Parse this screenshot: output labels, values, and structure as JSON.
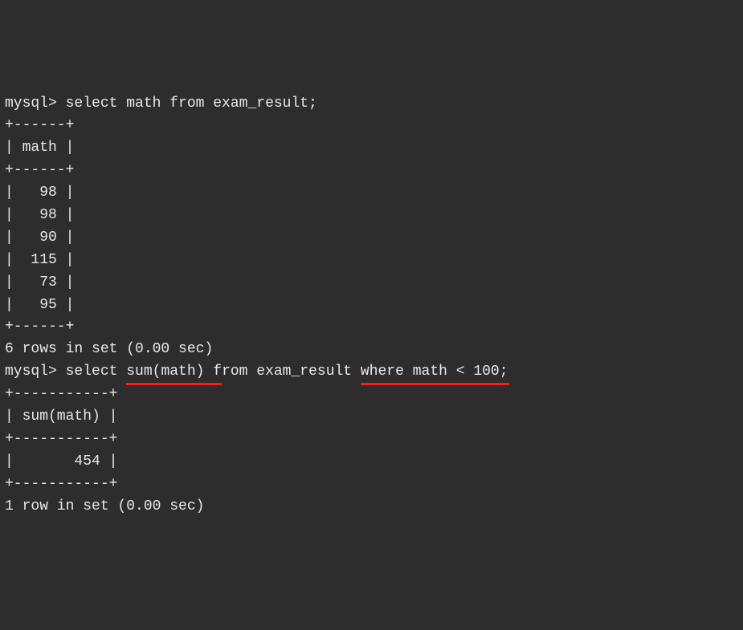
{
  "terminal": {
    "prompt": "mysql>",
    "query1": "select math from exam_result;",
    "table1": {
      "top_border": "+------+",
      "header_row": "| math |",
      "mid_border": "+------+",
      "rows": [
        "|   98 |",
        "|   98 |",
        "|   90 |",
        "|  115 |",
        "|   73 |",
        "|   95 |"
      ],
      "bottom_border": "+------+"
    },
    "result1_msg": "6 rows in set (0.00 sec)",
    "blank": "",
    "query2_prefix": "select ",
    "query2_sum": "sum(math)",
    "query2_mid": " from exam_result ",
    "query2_where": "where math < 100",
    "query2_suffix": ";",
    "table2": {
      "top_border": "+-----------+",
      "header_row": "| sum(math) |",
      "mid_border": "+-----------+",
      "data_row": "|       454 |",
      "bottom_border": "+-----------+"
    },
    "result2_msg": "1 row in set (0.00 sec)"
  },
  "chart_data": [
    {
      "type": "table",
      "title": "select math from exam_result",
      "columns": [
        "math"
      ],
      "rows": [
        [
          98
        ],
        [
          98
        ],
        [
          90
        ],
        [
          115
        ],
        [
          73
        ],
        [
          95
        ]
      ],
      "footer": "6 rows in set (0.00 sec)"
    },
    {
      "type": "table",
      "title": "select sum(math) from exam_result where math < 100",
      "columns": [
        "sum(math)"
      ],
      "rows": [
        [
          454
        ]
      ],
      "footer": "1 row in set (0.00 sec)"
    }
  ]
}
